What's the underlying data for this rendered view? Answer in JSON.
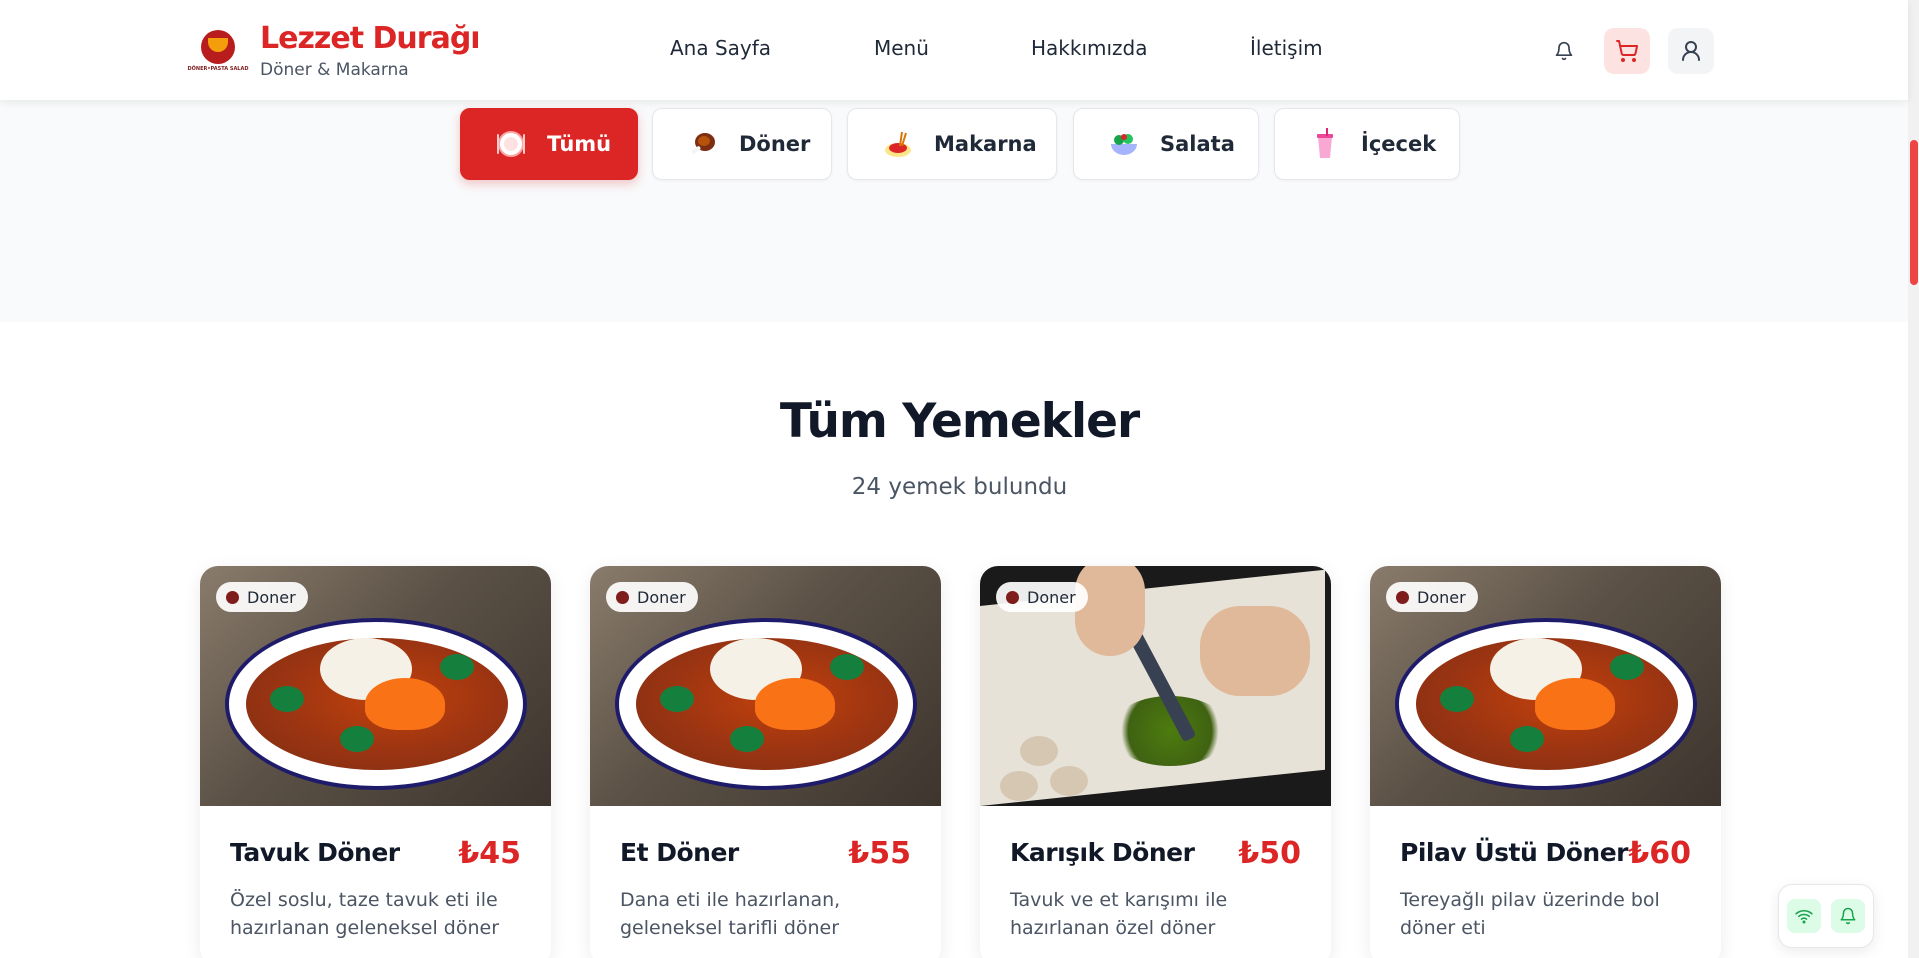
{
  "brand": {
    "name": "Lezzet Durağı",
    "subtitle": "Döner & Makarna",
    "logo_text": "DÖNER•PASTA SALAD"
  },
  "nav": {
    "items": [
      "Ana Sayfa",
      "Menü",
      "Hakkımızda",
      "İletişim"
    ]
  },
  "header_actions": {
    "bell_icon": "bell-icon",
    "cart_icon": "cart-icon",
    "user_icon": "user-icon"
  },
  "categories": [
    {
      "label": "Tümü",
      "icon": "plate-icon",
      "active": true
    },
    {
      "label": "Döner",
      "icon": "meat-icon",
      "active": false
    },
    {
      "label": "Makarna",
      "icon": "pasta-icon",
      "active": false
    },
    {
      "label": "Salata",
      "icon": "salad-icon",
      "active": false
    },
    {
      "label": "İçecek",
      "icon": "drink-icon",
      "active": false
    }
  ],
  "section": {
    "title": "Tüm Yemekler",
    "subtitle": "24 yemek bulundu"
  },
  "dishes": [
    {
      "badge": "Doner",
      "name": "Tavuk Döner",
      "price": "₺45",
      "description": "Özel soslu, taze tavuk eti ile hazırlanan geleneksel döner"
    },
    {
      "badge": "Doner",
      "name": "Et Döner",
      "price": "₺55",
      "description": "Dana eti ile hazırlanan, geleneksel tarifli döner"
    },
    {
      "badge": "Doner",
      "name": "Karışık Döner",
      "price": "₺50",
      "description": "Tavuk ve et karışımı ile hazırlanan özel döner"
    },
    {
      "badge": "Doner",
      "name": "Pilav Üstü Döner",
      "price": "₺60",
      "description": "Tereyağlı pilav üzerinde bol döner eti"
    }
  ],
  "colors": {
    "accent": "#dc2626",
    "background_band": "#f9fafb",
    "text_dark": "#111827",
    "text_muted": "#4b5563"
  }
}
